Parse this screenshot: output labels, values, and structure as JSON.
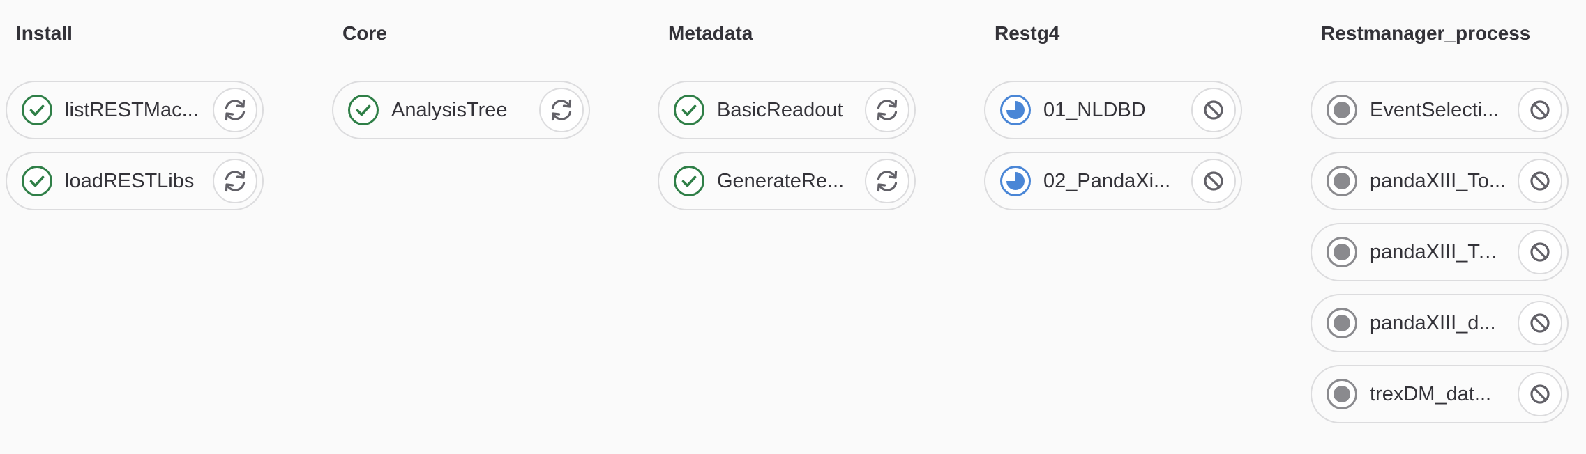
{
  "colors": {
    "success": "#2f7f47",
    "running": "#4a86d6",
    "created": "#8a8a8e",
    "action_icon": "#626168",
    "border": "#dcdcde",
    "text": "#333238"
  },
  "stages": [
    {
      "name": "Install",
      "jobs": [
        {
          "name": "listRESTMac...",
          "status": "success",
          "status_icon": "status-success-icon",
          "action": "retry",
          "action_icon": "retry-icon"
        },
        {
          "name": "loadRESTLibs",
          "status": "success",
          "status_icon": "status-success-icon",
          "action": "retry",
          "action_icon": "retry-icon"
        }
      ]
    },
    {
      "name": "Core",
      "jobs": [
        {
          "name": "AnalysisTree",
          "status": "success",
          "status_icon": "status-success-icon",
          "action": "retry",
          "action_icon": "retry-icon"
        }
      ]
    },
    {
      "name": "Metadata",
      "jobs": [
        {
          "name": "BasicReadout",
          "status": "success",
          "status_icon": "status-success-icon",
          "action": "retry",
          "action_icon": "retry-icon"
        },
        {
          "name": "GenerateRe...",
          "status": "success",
          "status_icon": "status-success-icon",
          "action": "retry",
          "action_icon": "retry-icon"
        }
      ]
    },
    {
      "name": "Restg4",
      "jobs": [
        {
          "name": "01_NLDBD",
          "status": "running",
          "status_icon": "status-running-icon",
          "action": "cancel",
          "action_icon": "cancel-icon"
        },
        {
          "name": "02_PandaXi...",
          "status": "running",
          "status_icon": "status-running-icon",
          "action": "cancel",
          "action_icon": "cancel-icon"
        }
      ]
    },
    {
      "name": "Restmanager_process",
      "jobs": [
        {
          "name": "EventSelecti...",
          "status": "created",
          "status_icon": "status-created-icon",
          "action": "cancel",
          "action_icon": "cancel-icon"
        },
        {
          "name": "pandaXIII_To...",
          "status": "created",
          "status_icon": "status-created-icon",
          "action": "cancel",
          "action_icon": "cancel-icon"
        },
        {
          "name": "pandaXIII_Top...",
          "status": "created",
          "status_icon": "status-created-icon",
          "action": "cancel",
          "action_icon": "cancel-icon"
        },
        {
          "name": "pandaXIII_d...",
          "status": "created",
          "status_icon": "status-created-icon",
          "action": "cancel",
          "action_icon": "cancel-icon"
        },
        {
          "name": "trexDM_dat...",
          "status": "created",
          "status_icon": "status-created-icon",
          "action": "cancel",
          "action_icon": "cancel-icon"
        }
      ]
    }
  ]
}
